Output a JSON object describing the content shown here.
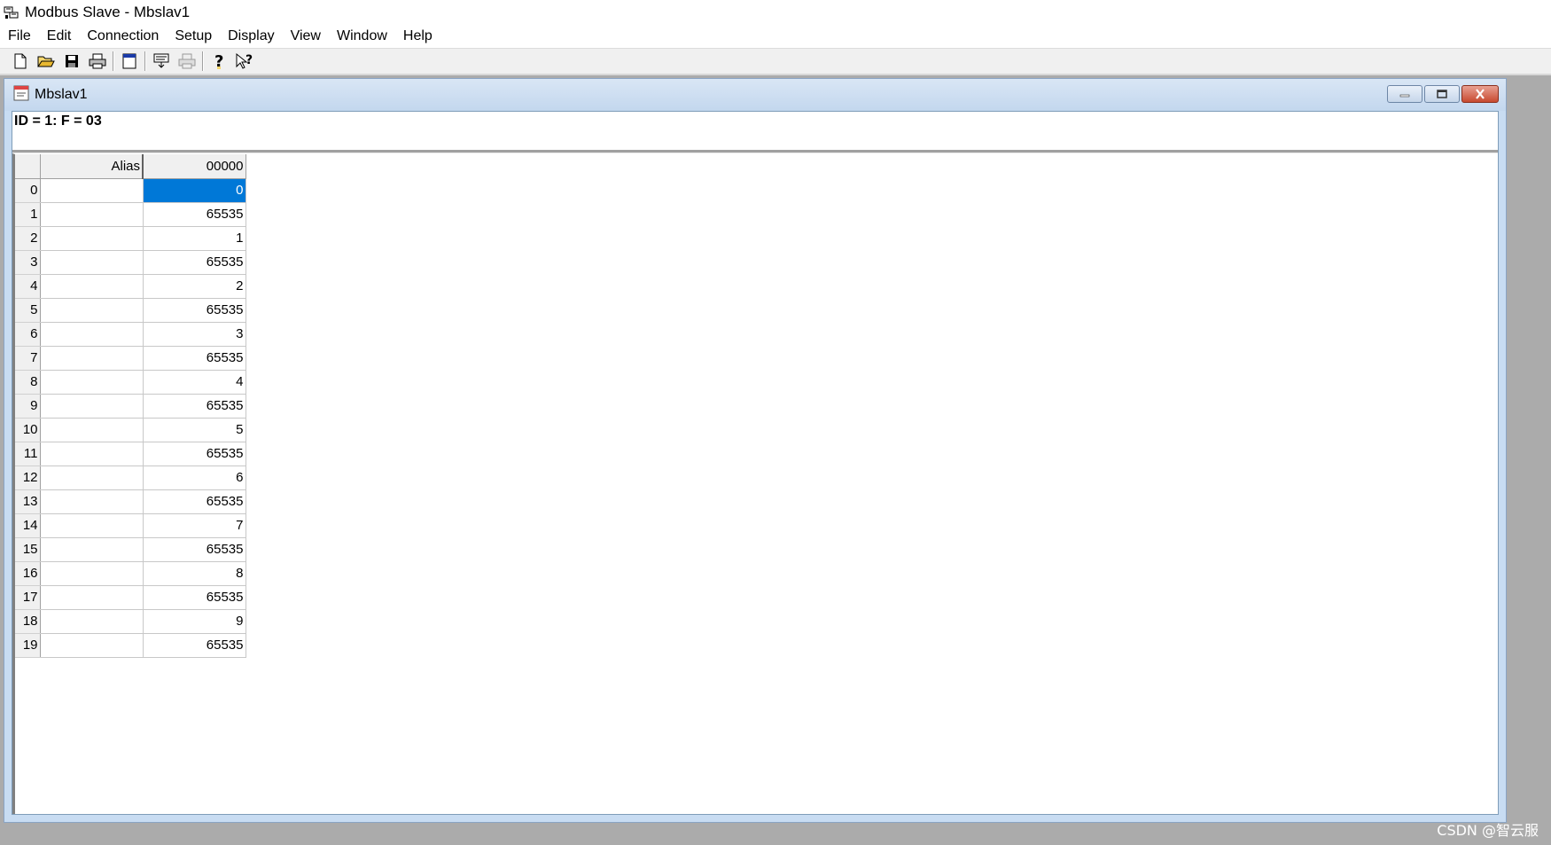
{
  "window": {
    "title": "Modbus Slave - Mbslav1"
  },
  "menu": [
    "File",
    "Edit",
    "Connection",
    "Setup",
    "Display",
    "View",
    "Window",
    "Help"
  ],
  "toolbar": {
    "icons": [
      "new-icon",
      "open-icon",
      "save-icon",
      "print-icon",
      "window-icon",
      "comm-traffic-icon",
      "print-preview-icon",
      "help-icon",
      "context-help-icon"
    ]
  },
  "child": {
    "title": "Mbslav1",
    "header": "ID = 1: F = 03"
  },
  "grid": {
    "columns": [
      "Alias",
      "00000"
    ],
    "rows": [
      {
        "n": "0",
        "alias": "",
        "value": "0"
      },
      {
        "n": "1",
        "alias": "",
        "value": "65535"
      },
      {
        "n": "2",
        "alias": "",
        "value": "1"
      },
      {
        "n": "3",
        "alias": "",
        "value": "65535"
      },
      {
        "n": "4",
        "alias": "",
        "value": "2"
      },
      {
        "n": "5",
        "alias": "",
        "value": "65535"
      },
      {
        "n": "6",
        "alias": "",
        "value": "3"
      },
      {
        "n": "7",
        "alias": "",
        "value": "65535"
      },
      {
        "n": "8",
        "alias": "",
        "value": "4"
      },
      {
        "n": "9",
        "alias": "",
        "value": "65535"
      },
      {
        "n": "10",
        "alias": "",
        "value": "5"
      },
      {
        "n": "11",
        "alias": "",
        "value": "65535"
      },
      {
        "n": "12",
        "alias": "",
        "value": "6"
      },
      {
        "n": "13",
        "alias": "",
        "value": "65535"
      },
      {
        "n": "14",
        "alias": "",
        "value": "7"
      },
      {
        "n": "15",
        "alias": "",
        "value": "65535"
      },
      {
        "n": "16",
        "alias": "",
        "value": "8"
      },
      {
        "n": "17",
        "alias": "",
        "value": "65535"
      },
      {
        "n": "18",
        "alias": "",
        "value": "9"
      },
      {
        "n": "19",
        "alias": "",
        "value": "65535"
      }
    ],
    "selected_row": 0
  },
  "watermark": "CSDN @智云服",
  "colors": {
    "selection": "#0078d7",
    "workspace": "#ababab",
    "child_frame": "#c8dcf2"
  }
}
